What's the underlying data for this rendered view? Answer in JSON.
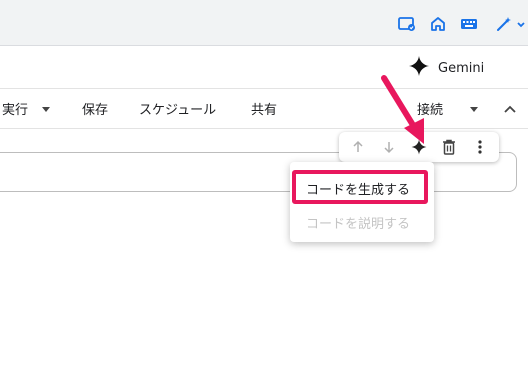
{
  "gemini": {
    "label": "Gemini"
  },
  "menu": {
    "run": "実行",
    "save": "保存",
    "schedule": "スケジュール",
    "share": "共有",
    "connect": "接続"
  },
  "context_menu": {
    "generate_code": "コードを生成する",
    "explain_code": "コードを説明する"
  },
  "icons": [
    "cast-icon",
    "home-icon",
    "keyboard-icon",
    "magic-wand-icon",
    "gemini-sparkle-icon",
    "caret-down-icon",
    "chevron-up-icon",
    "arrow-up-icon",
    "arrow-down-icon",
    "sparkle-icon",
    "trash-icon",
    "more-vert-icon"
  ],
  "colors": {
    "accent_blue": "#1a73e8",
    "highlight": "#e8175d",
    "disabled_text": "#c4c4c4"
  }
}
